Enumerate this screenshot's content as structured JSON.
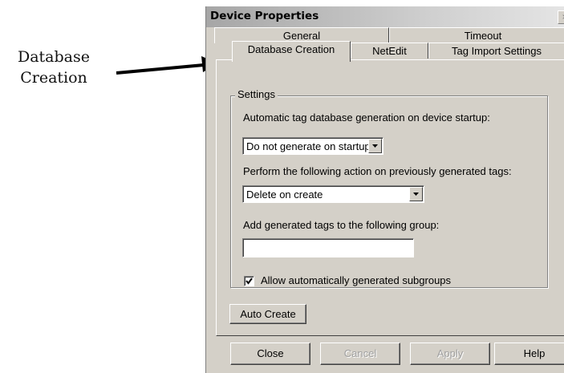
{
  "callout": {
    "line1": "Database",
    "line2": "Creation"
  },
  "dialog": {
    "title": "Device Properties",
    "close_glyph": "×"
  },
  "tabs": {
    "row1": [
      {
        "label": "General"
      },
      {
        "label": "Timeout"
      }
    ],
    "row2": [
      {
        "label": "Database Creation",
        "active": true
      },
      {
        "label": "NetEdit"
      },
      {
        "label": "Tag Import Settings"
      }
    ]
  },
  "settings": {
    "group_label": "Settings",
    "auto_generate_label": "Automatic tag database generation on device startup:",
    "auto_generate_value": "Do not generate on startup",
    "previous_tags_label": "Perform the following action on previously generated tags:",
    "previous_tags_value": "Delete on create",
    "group_field_label": "Add generated tags to the following group:",
    "group_field_value": "",
    "subgroups_label": "Allow automatically generated subgroups",
    "subgroups_checked": true
  },
  "auto_create_button": "Auto Create",
  "footer": {
    "close": "Close",
    "cancel": "Cancel",
    "apply": "Apply",
    "help": "Help"
  },
  "colors": {
    "dialog_face": "#d4d0c8",
    "titlebar_start": "#a6a6a6",
    "titlebar_end": "#e6e6e6",
    "disabled_text": "#a0a0a0"
  }
}
